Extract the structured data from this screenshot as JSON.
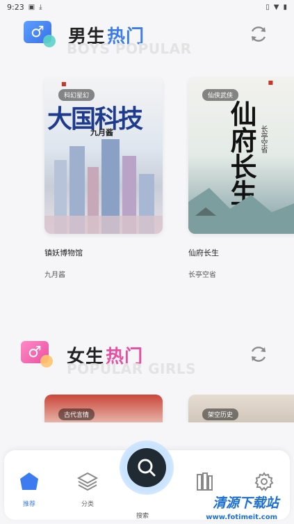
{
  "status_bar": {
    "time": "9:23"
  },
  "boys": {
    "title_a": "男生",
    "title_b": "热门",
    "subtitle": "BOYS POPULAR",
    "accent": "#4a8df0",
    "books": [
      {
        "tag": "科幻星幻",
        "cover_text": "大国科技",
        "cover_author": "九月酱",
        "title": "镇妖博物馆",
        "author": "九月酱"
      },
      {
        "tag": "仙侠武侠",
        "cover_text": "仙府长生",
        "cover_author": "长亭空省",
        "title": "仙府长生",
        "author": "长亭空省"
      }
    ]
  },
  "girls": {
    "title_a": "女生",
    "title_b": "热门",
    "subtitle": "POPULAR GIRLS",
    "accent": "#e94fa0",
    "books": [
      {
        "tag": "古代言情"
      },
      {
        "tag": "架空历史"
      }
    ]
  },
  "tabbar": {
    "recommend": "推荐",
    "category": "分类",
    "search": "搜索"
  },
  "watermark": {
    "main": "清源下载站",
    "url": "www.fotimeit.com"
  }
}
